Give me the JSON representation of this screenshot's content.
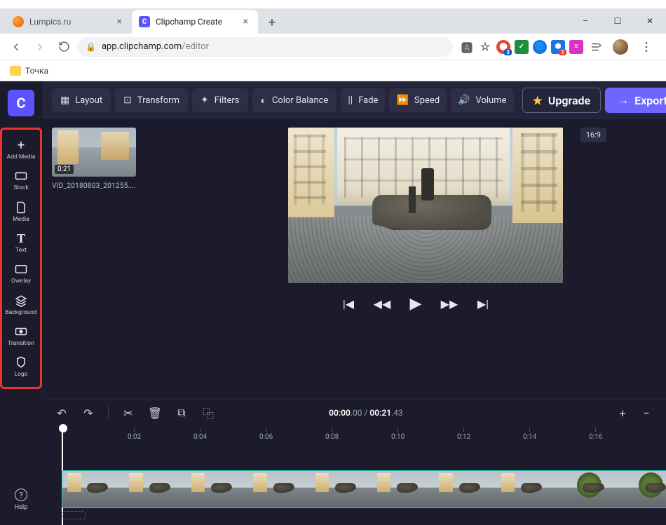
{
  "window": {
    "minimize": "–",
    "maximize": "☐",
    "close": "✕"
  },
  "tabs": {
    "items": [
      {
        "title": "Lumpics.ru",
        "active": false
      },
      {
        "title": "Clipchamp Create",
        "active": true
      }
    ],
    "newtab_glyph": "+"
  },
  "url": {
    "lock": "🔒",
    "host": "app.clipchamp.com",
    "path": "/editor"
  },
  "bookmarks": {
    "items": [
      {
        "label": "Точка"
      }
    ]
  },
  "brand": {
    "letter": "C"
  },
  "sidebar": {
    "items": [
      {
        "icon": "+",
        "label": "Add Media"
      },
      {
        "icon": "⌧",
        "label": "Stock"
      },
      {
        "icon": "🗎",
        "label": "Media"
      },
      {
        "icon": "T",
        "label": "Text"
      },
      {
        "icon": "▭",
        "label": "Overlay"
      },
      {
        "icon": "≋",
        "label": "Background"
      },
      {
        "icon": "⇆",
        "label": "Transition"
      },
      {
        "icon": "⬡",
        "label": "Logo"
      }
    ],
    "help": {
      "icon": "?",
      "label": "Help"
    }
  },
  "toolbar": {
    "items": [
      {
        "icon": "▦",
        "label": "Layout"
      },
      {
        "icon": "⊡",
        "label": "Transform"
      },
      {
        "icon": "✦",
        "label": "Filters"
      },
      {
        "icon": "◐",
        "label": "Color Balance"
      },
      {
        "icon": "||",
        "label": "Fade"
      },
      {
        "icon": "⏩",
        "label": "Speed"
      },
      {
        "icon": "🔊",
        "label": "Volume"
      }
    ],
    "upgrade": {
      "star": "★",
      "label": "Upgrade"
    },
    "export": {
      "arrow": "→",
      "label": "Export"
    }
  },
  "media": {
    "thumb_duration": "0:21",
    "thumb_name": "VID_20180803_201255...."
  },
  "preview": {
    "aspect": "16:9"
  },
  "playback": {
    "prev": "|◀",
    "rew": "◀◀",
    "play": "▶",
    "ffw": "▶▶",
    "next": "▶|"
  },
  "tools": {
    "undo": "↶",
    "redo": "↷",
    "cut": "✂",
    "delete": "🗑",
    "copy": "⧉",
    "dup": "⿻",
    "zoom_in": "+",
    "zoom_out": "−",
    "fit": "↔"
  },
  "timecode": {
    "now": "00:00",
    "now_frac": ".00",
    "sep": " / ",
    "dur": "00:21",
    "dur_frac": ".43"
  },
  "ruler": {
    "ticks": [
      "0:02",
      "0:04",
      "0:06",
      "0:08",
      "0:10",
      "0:12",
      "0:14",
      "0:16"
    ]
  },
  "clip": {
    "audio_glyph": "🔊"
  }
}
